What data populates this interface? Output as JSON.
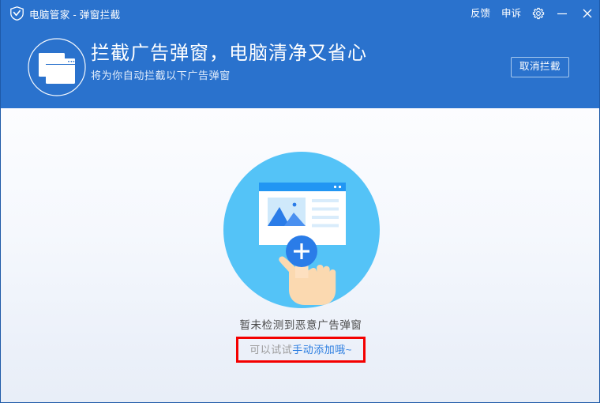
{
  "window": {
    "titlebar": {
      "icon": "shield-icon",
      "app_title": "电脑管家 - 弹窗拦截",
      "actions": [
        {
          "type": "text",
          "label": "反馈",
          "name": "feedback-button"
        },
        {
          "type": "text",
          "label": "申诉",
          "name": "appeal-button"
        },
        {
          "type": "icon",
          "label": "gear-icon",
          "name": "settings-button"
        },
        {
          "type": "icon",
          "label": "minimize-icon",
          "name": "minimize-button"
        },
        {
          "type": "icon",
          "label": "close-icon",
          "name": "close-button"
        }
      ],
      "feedback_label": "反馈",
      "appeal_label": "申诉"
    },
    "banner": {
      "icon": "stacked-windows-icon",
      "title": "拦截广告弹窗，电脑清净又省心",
      "subtitle": "将为你自动拦截以下广告弹窗",
      "action_label": "取消拦截"
    },
    "main": {
      "illustration": {
        "name": "add-popup-illustration",
        "circle_color": "#54c3f7",
        "plus_badge_color": "#2a7ce8",
        "card_titlebar_color": "#2196f3"
      },
      "empty_title": "暂未检测到恶意广告弹窗",
      "hint_prefix": "可以试试",
      "hint_link": "手动添加哦~",
      "highlight_color": "#f40000"
    },
    "colors": {
      "brand_blue": "#2a72cd",
      "body_gradient_top": "#ffffff",
      "body_gradient_bottom": "#e8eef8",
      "border": "#1f5aa8",
      "link_blue": "#2b7de0",
      "muted_text": "#9a9a9a",
      "body_text": "#4a4a4a"
    }
  }
}
